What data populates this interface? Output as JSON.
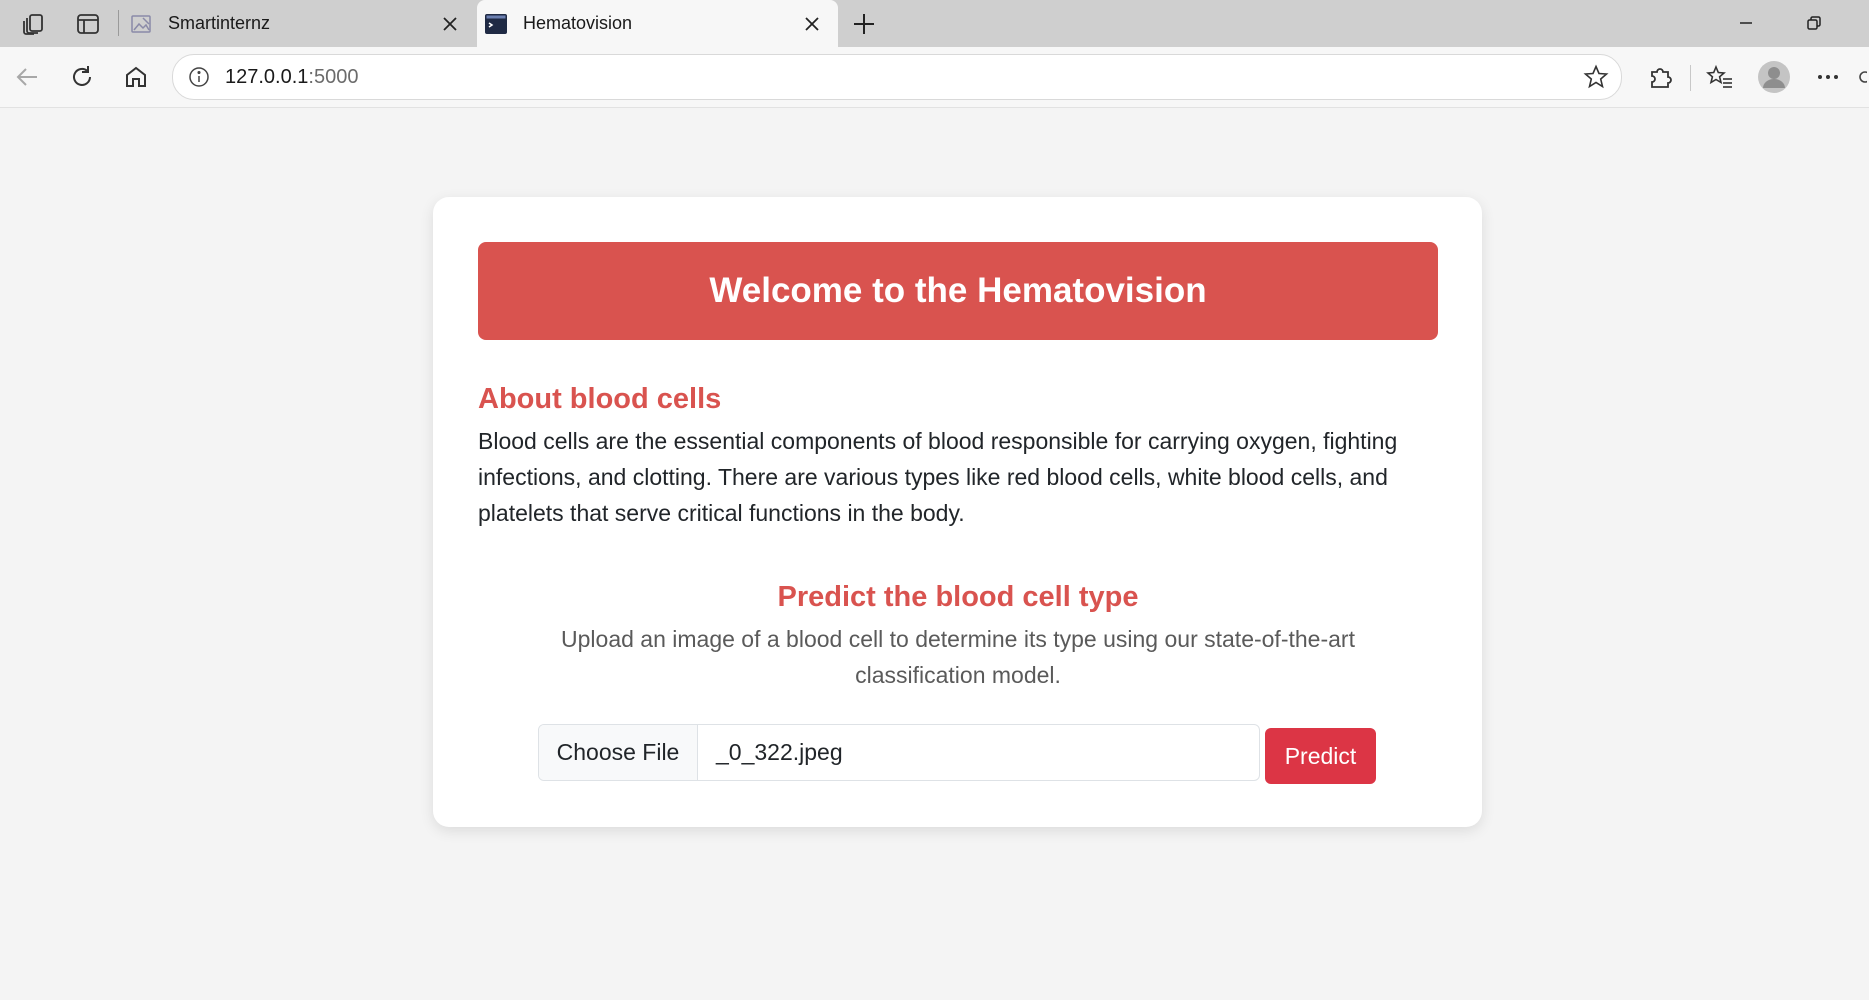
{
  "browser": {
    "tabs": [
      {
        "title": "Smartinternz",
        "active": false,
        "favicon": "image-icon"
      },
      {
        "title": "Hematovision",
        "active": true,
        "favicon": "terminal-icon"
      }
    ],
    "address_bar": {
      "host": "127.0.0.1",
      "port": ":5000"
    }
  },
  "page": {
    "banner_title": "Welcome to the Hematovision",
    "about": {
      "heading": "About blood cells",
      "body": "Blood cells are the essential components of blood responsible for carrying oxygen, fighting infections, and clotting. There are various types like red blood cells, white blood cells, and platelets that serve critical functions in the body."
    },
    "predict": {
      "heading": "Predict the blood cell type",
      "description": "Upload an image of a blood cell to determine its type using our state-of-the-art classification model.",
      "file_button_label": "Choose File",
      "file_name": "_0_322.jpeg",
      "submit_label": "Predict"
    }
  },
  "colors": {
    "accent": "#d9534f",
    "button": "#dc3545",
    "card": "#ffffff",
    "background": "#f4f4f4"
  }
}
